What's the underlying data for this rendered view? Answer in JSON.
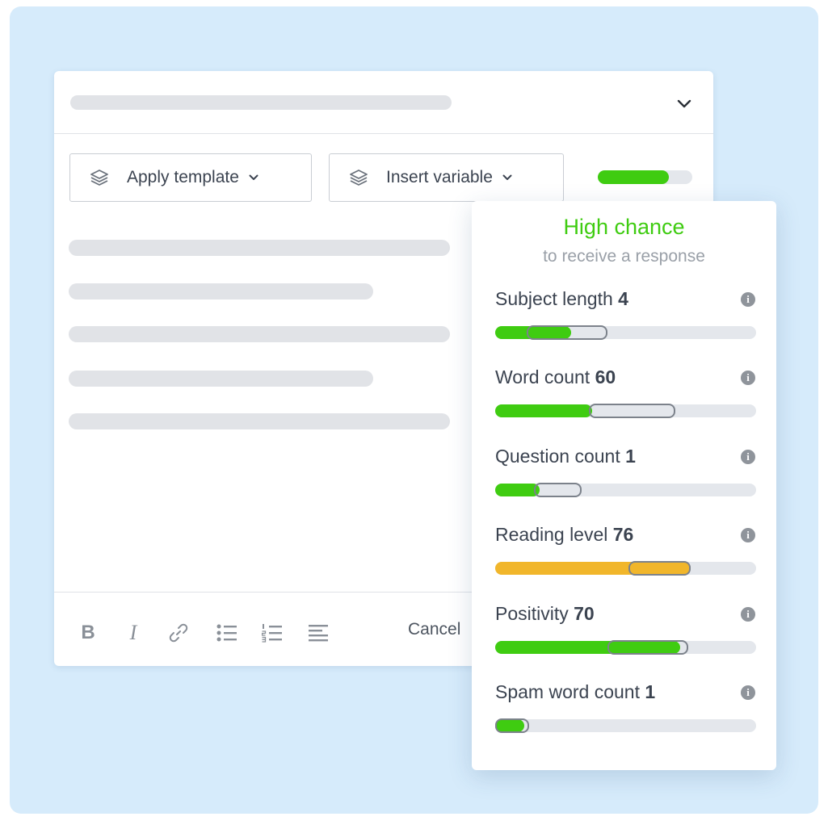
{
  "editor": {
    "toolbar": {
      "apply_template": "Apply template",
      "insert_variable": "Insert variable",
      "score": 0.75
    },
    "footer": {
      "bold_label": "B",
      "italic_label": "I",
      "cancel_label": "Cancel"
    }
  },
  "panel": {
    "title": "High chance",
    "subtitle": "to receive a response",
    "metrics": [
      {
        "label": "Subject length",
        "value": "4",
        "fill": 0.29,
        "range": [
          0.12,
          0.43
        ],
        "color": "#3fcc11"
      },
      {
        "label": "Word count",
        "value": "60",
        "fill": 0.37,
        "range": [
          0.36,
          0.69
        ],
        "color": "#3fcc11"
      },
      {
        "label": "Question count",
        "value": "1",
        "fill": 0.17,
        "range": [
          0.15,
          0.33
        ],
        "color": "#3fcc11"
      },
      {
        "label": "Reading level",
        "value": "76",
        "fill": 0.75,
        "range": [
          0.51,
          0.75
        ],
        "color": "#f1b62b"
      },
      {
        "label": "Positivity",
        "value": "70",
        "fill": 0.71,
        "range": [
          0.43,
          0.74
        ],
        "color": "#3fcc11"
      },
      {
        "label": "Spam word count",
        "value": "1",
        "fill": 0.11,
        "range": [
          0.0,
          0.13
        ],
        "color": "#3fcc11"
      }
    ]
  },
  "colors": {
    "background": "#d6ebfb",
    "success": "#3fcc11",
    "warning": "#f1b62b",
    "skeleton": "#e1e3e7"
  }
}
